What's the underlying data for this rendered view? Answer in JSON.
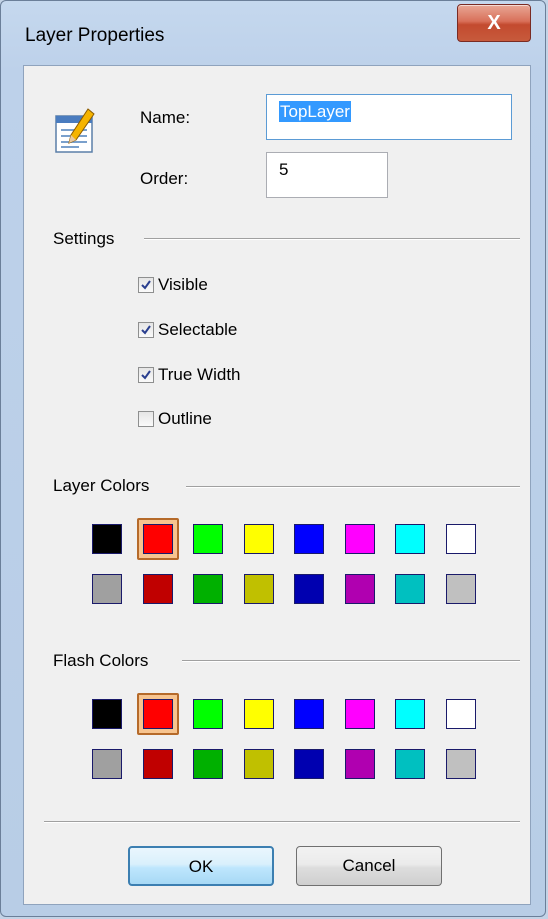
{
  "window": {
    "title": "Layer Properties",
    "close_label": "X"
  },
  "fields": {
    "name_label": "Name:",
    "name_value": "TopLayer",
    "order_label": "Order:",
    "order_value": "5"
  },
  "settings": {
    "heading": "Settings",
    "options": [
      {
        "label": "Visible",
        "checked": true
      },
      {
        "label": "Selectable",
        "checked": true
      },
      {
        "label": "True Width",
        "checked": true
      },
      {
        "label": "Outline",
        "checked": false
      }
    ]
  },
  "layer_colors": {
    "heading": "Layer Colors",
    "selected_index": 1,
    "rows": [
      [
        "#000000",
        "#ff0000",
        "#00ff00",
        "#ffff00",
        "#0000ff",
        "#ff00ff",
        "#00ffff",
        "#ffffff"
      ],
      [
        "#a0a0a0",
        "#c00000",
        "#00b000",
        "#c0c000",
        "#0000b0",
        "#b000b0",
        "#00c0c0",
        "#c0c0c0"
      ]
    ]
  },
  "flash_colors": {
    "heading": "Flash Colors",
    "selected_index": 1,
    "rows": [
      [
        "#000000",
        "#ff0000",
        "#00ff00",
        "#ffff00",
        "#0000ff",
        "#ff00ff",
        "#00ffff",
        "#ffffff"
      ],
      [
        "#a0a0a0",
        "#c00000",
        "#00b000",
        "#c0c000",
        "#0000b0",
        "#b000b0",
        "#00c0c0",
        "#c0c0c0"
      ]
    ]
  },
  "buttons": {
    "ok": "OK",
    "cancel": "Cancel"
  },
  "icons": {
    "properties": "edit-document-icon",
    "close": "close-icon"
  }
}
